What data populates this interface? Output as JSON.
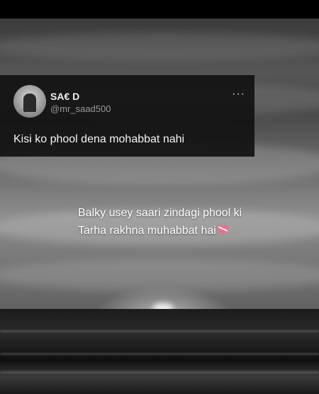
{
  "tweet": {
    "display_name": "SA€ D",
    "handle": "@mr_saad500",
    "text": "Kisi ko phool dena mohabbat nahi",
    "more_symbol": "···"
  },
  "caption": {
    "line1": "Balky usey saari  zindagi phool ki",
    "line2": "Tarha rakhna muhabbat hai",
    "emoji_icon": "heart-with-ribbon-icon"
  },
  "colors": {
    "card_bg": "#121212",
    "text_light": "#f4f4f4",
    "handle_gray": "#9a9a9a",
    "heart_pink": "#f06a8a"
  }
}
